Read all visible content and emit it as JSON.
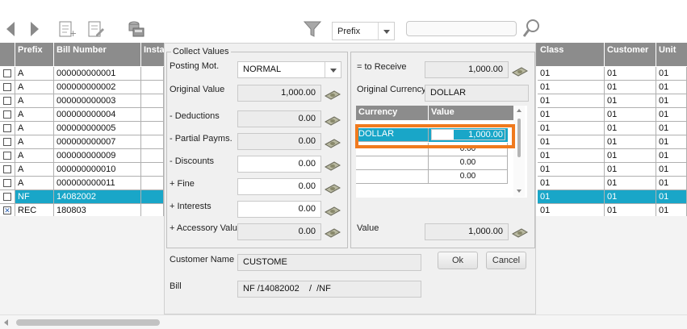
{
  "toolbar": {
    "prefix_value": "Prefix",
    "search_value": ""
  },
  "grid": {
    "columns": [
      "Prefix",
      "Bill Number",
      "Insta",
      "Class",
      "Customer",
      "Unit"
    ],
    "rows": [
      {
        "checked": false,
        "prefix": "A",
        "bill": "000000000001",
        "class": "01",
        "customer": "01",
        "unit": "01"
      },
      {
        "checked": false,
        "prefix": "A",
        "bill": "000000000002",
        "class": "01",
        "customer": "01",
        "unit": "01"
      },
      {
        "checked": false,
        "prefix": "A",
        "bill": "000000000003",
        "class": "01",
        "customer": "01",
        "unit": "01"
      },
      {
        "checked": false,
        "prefix": "A",
        "bill": "000000000004",
        "class": "01",
        "customer": "01",
        "unit": "01"
      },
      {
        "checked": false,
        "prefix": "A",
        "bill": "000000000005",
        "class": "01",
        "customer": "01",
        "unit": "01"
      },
      {
        "checked": false,
        "prefix": "A",
        "bill": "000000000007",
        "class": "01",
        "customer": "01",
        "unit": "01"
      },
      {
        "checked": false,
        "prefix": "A",
        "bill": "000000000009",
        "class": "01",
        "customer": "01",
        "unit": "01"
      },
      {
        "checked": false,
        "prefix": "A",
        "bill": "000000000010",
        "class": "01",
        "customer": "01",
        "unit": "01"
      },
      {
        "checked": false,
        "prefix": "A",
        "bill": "000000000011",
        "class": "01",
        "customer": "01",
        "unit": "01"
      },
      {
        "checked": false,
        "prefix": "NF",
        "bill": "14082002",
        "class": "01",
        "customer": "01",
        "unit": "01",
        "selected": true
      },
      {
        "checked": true,
        "prefix": "REC",
        "bill": "180803",
        "class": "01",
        "customer": "01",
        "unit": "01"
      }
    ]
  },
  "dialog": {
    "group_title": "Collect Values",
    "posting_label": "Posting Mot.",
    "posting_value": "NORMAL",
    "original_value_label": "Original Value",
    "original_value": "1,000.00",
    "deductions_label": "- Deductions",
    "deductions_value": "0.00",
    "partial_label": "- Partial Payms.",
    "partial_value": "0.00",
    "discounts_label": "- Discounts",
    "discounts_value": "0.00",
    "fine_label": "+ Fine",
    "fine_value": "0.00",
    "interests_label": "+ Interests",
    "interests_value": "0.00",
    "accessory_label": "+ Accessory Valu",
    "accessory_value": "0.00",
    "to_receive_label": "= to Receive",
    "to_receive_value": "1,000.00",
    "orig_currency_label": "Original Currency",
    "orig_currency_value": "DOLLAR",
    "currency_table": {
      "headers": [
        "Currency",
        "Value"
      ],
      "rows": [
        {
          "currency": "DOLLAR",
          "value": "1,000.00"
        },
        {
          "currency": "",
          "value": "0.00"
        },
        {
          "currency": "",
          "value": "0.00"
        },
        {
          "currency": "",
          "value": "0.00"
        }
      ]
    },
    "value_label": "Value",
    "value_value": "1,000.00",
    "customer_name_label": "Customer Name",
    "customer_name_value": "CUSTOME",
    "bill_label": "Bill",
    "bill_value": "NF /14082002    /  /NF",
    "ok_label": "Ok",
    "cancel_label": "Cancel"
  },
  "colors": {
    "header_bg": "#8c8c8c",
    "selection": "#19a6c8",
    "highlight_border": "#f07a1e"
  }
}
